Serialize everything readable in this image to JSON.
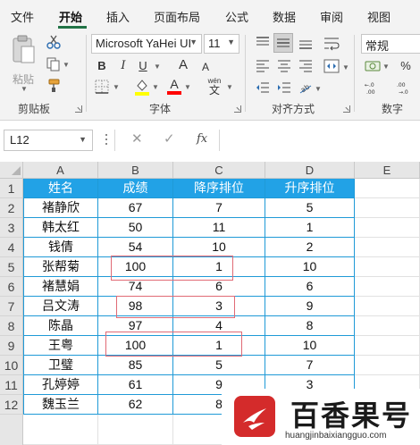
{
  "menu": {
    "tabs": [
      "文件",
      "开始",
      "插入",
      "页面布局",
      "公式",
      "数据",
      "审阅",
      "视图"
    ],
    "active_tab": "开始"
  },
  "ribbon": {
    "clipboard": {
      "paste_label": "粘贴",
      "group_label": "剪贴板"
    },
    "font": {
      "font_name": "Microsoft YaHei UI",
      "font_size": "11",
      "bold": "B",
      "italic": "I",
      "underline": "U",
      "grow": "A",
      "shrink": "A",
      "phonetic": "wén",
      "group_label": "字体",
      "fill_color": "#ffff00",
      "font_color": "#ff0000"
    },
    "alignment": {
      "group_label": "对齐方式"
    },
    "number": {
      "format": "常规",
      "group_label": "数字",
      "percent": "%"
    }
  },
  "formula_bar": {
    "cell_ref": "L12",
    "fx": "fx",
    "cancel": "✕",
    "confirm": "✓",
    "value": ""
  },
  "grid": {
    "columns": [
      "A",
      "B",
      "C",
      "D",
      "E"
    ],
    "rows": [
      "1",
      "2",
      "3",
      "4",
      "5",
      "6",
      "7",
      "8",
      "9",
      "10",
      "11",
      "12"
    ],
    "header": [
      "姓名",
      "成绩",
      "降序排位",
      "升序排位"
    ],
    "data": [
      [
        "褚静欣",
        "67",
        "7",
        "5"
      ],
      [
        "韩太红",
        "50",
        "11",
        "1"
      ],
      [
        "钱倩",
        "54",
        "10",
        "2"
      ],
      [
        "张帮菊",
        "100",
        "1",
        "10"
      ],
      [
        "褚慧娟",
        "74",
        "6",
        "6"
      ],
      [
        "吕文涛",
        "98",
        "3",
        "9"
      ],
      [
        "陈晶",
        "97",
        "4",
        "8"
      ],
      [
        "王粤",
        "100",
        "1",
        "10"
      ],
      [
        "卫璧",
        "85",
        "5",
        "7"
      ],
      [
        "孔婷婷",
        "61",
        "9",
        "3"
      ],
      [
        "魏玉兰",
        "62",
        "8",
        ""
      ]
    ],
    "table_color": "#22a2e6",
    "highlight_color": "#e06a75"
  },
  "watermark": {
    "title": "百香果号",
    "url": "huangjinbaixiangguo.com",
    "logo_color": "#d42b2b"
  }
}
